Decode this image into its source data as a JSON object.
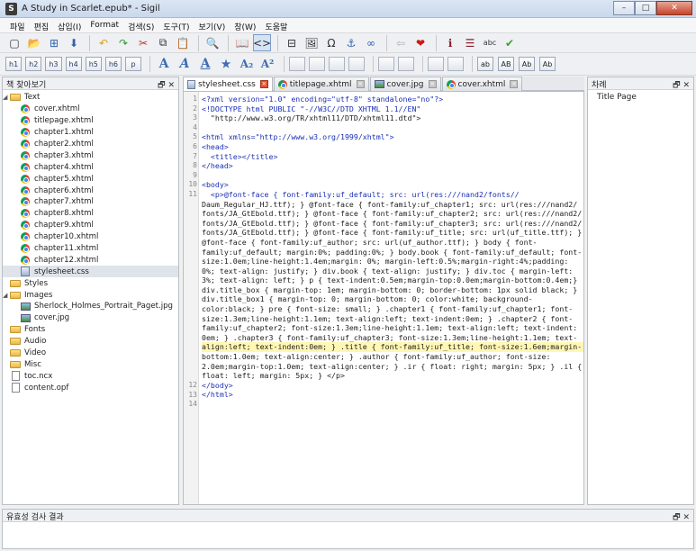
{
  "window": {
    "title": "A Study in Scarlet.epub* - Sigil",
    "app_icon": "S"
  },
  "menu": [
    "파일",
    "편집",
    "삽입(I)",
    "Format",
    "검색(S)",
    "도구(T)",
    "보기(V)",
    "창(W)",
    "도움말"
  ],
  "heading_buttons": [
    "h1",
    "h2",
    "h3",
    "h4",
    "h5",
    "h6",
    "p"
  ],
  "case_buttons": [
    "ab",
    "AB",
    "Ab",
    "Ab"
  ],
  "book_browser": {
    "title": "책 찾아보기",
    "text_folder": "Text",
    "text_files": [
      "cover.xhtml",
      "titlepage.xhtml",
      "chapter1.xhtml",
      "chapter2.xhtml",
      "chapter3.xhtml",
      "chapter4.xhtml",
      "chapter5.xhtml",
      "chapter6.xhtml",
      "chapter7.xhtml",
      "chapter8.xhtml",
      "chapter9.xhtml",
      "chapter10.xhtml",
      "chapter11.xhtml",
      "chapter12.xhtml"
    ],
    "stylesheet": "stylesheet.css",
    "styles_folder": "Styles",
    "images_folder": "Images",
    "image_files": [
      "Sherlock_Holmes_Portrait_Paget.jpg",
      "cover.jpg"
    ],
    "fonts_folder": "Fonts",
    "audio_folder": "Audio",
    "video_folder": "Video",
    "misc_folder": "Misc",
    "toc_file": "toc.ncx",
    "opf_file": "content.opf"
  },
  "tabs": [
    {
      "label": "stylesheet.css",
      "active": true
    },
    {
      "label": "titlepage.xhtml",
      "active": false
    },
    {
      "label": "cover.jpg",
      "active": false
    },
    {
      "label": "cover.xhtml",
      "active": false
    }
  ],
  "code_lines": [
    "<?xml version=\"1.0\" encoding=\"utf-8\" standalone=\"no\"?>",
    "<!DOCTYPE html PUBLIC \"-//W3C//DTD XHTML 1.1//EN\"",
    "  \"http://www.w3.org/TR/xhtml11/DTD/xhtml11.dtd\">",
    "",
    "<html xmlns=\"http://www.w3.org/1999/xhtml\">",
    "<head>",
    "  <title></title>",
    "</head>",
    "",
    "<body>",
    "  <p>@font-face { font-family:uf_default; src: url(res:///nand2/fonts//",
    "Daum_Regular_HJ.ttf); } @font-face { font-family:uf_chapter1; src: url(res:///nand2/",
    "fonts/JA_GtEbold.ttf); } @font-face { font-family:uf_chapter2; src: url(res:///nand2/",
    "fonts/JA_GtEbold.ttf); } @font-face { font-family:uf_chapter3; src: url(res:///nand2/",
    "fonts/JA_GtEbold.ttf); } @font-face { font-family:uf_title; src: url(uf_title.ttf); }",
    "@font-face { font-family:uf_author; src: url(uf_author.ttf); } body { font-",
    "family:uf_default; margin:0%; padding:0%; } body.book { font-family:uf_default; font-",
    "size:1.0em;line-height:1.4em;margin: 0%; margin-left:0.5%;margin-right:4%;padding:",
    "0%; text-align: justify; } div.book { text-align: justify; } div.toc { margin-left:",
    "3%; text-align: left; } p { text-indent:0.5em;margin-top:0.0em;margin-bottom:0.4em;}",
    "div.title_box { margin-top: 1em; margin-bottom: 0; border-bottom: 1px solid black; }",
    "div.title_box1 { margin-top: 0; margin-bottom: 0; color:white; background-",
    "color:black; } pre { font-size: small; } .chapter1 { font-family:uf_chapter1; font-",
    "size:1.3em;line-height:1.1em; text-align:left; text-indent:0em; } .chapter2 { font-",
    "family:uf_chapter2; font-size:1.3em;line-height:1.1em; text-align:left; text-indent:",
    "0em; } .chapter3 { font-family:uf_chapter3; font-size:1.3em;line-height:1.1em; text-",
    "align:left; text-indent:0em; } .title { font-family:uf_title; font-size:1.6em;margin-",
    "bottom:1.0em; text-align:center; } .author { font-family:uf_author; font-size:",
    "2.0em;margin-top:1.0em; text-align:center; } .ir { float: right; margin: 5px; } .il {",
    "float: left; margin: 5px; } </p>",
    "</body>",
    "</html>",
    ""
  ],
  "line_numbers": [
    "1",
    "2",
    "3",
    "4",
    "5",
    "6",
    "7",
    "8",
    "9",
    "10",
    "11",
    "12",
    "13",
    "14"
  ],
  "highlight_line_index": 26,
  "toc_panel": {
    "title": "차례",
    "items": [
      "Title Page"
    ]
  },
  "validation_panel": {
    "title": "유효성 검사 결과"
  },
  "panel_controls": "🗗 ✕"
}
